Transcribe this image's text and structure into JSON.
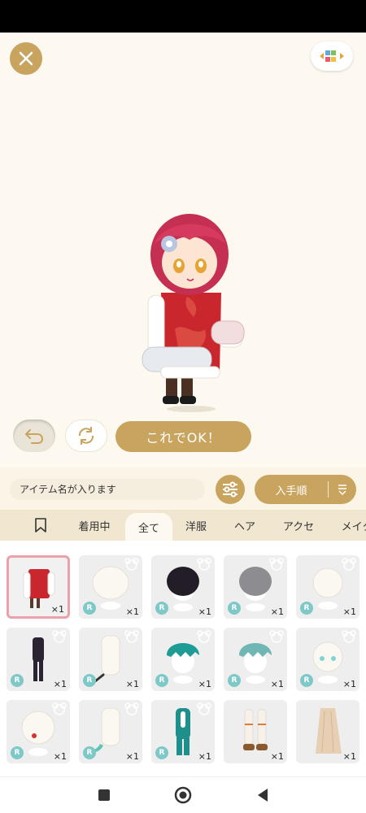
{
  "header": {
    "close_icon": "close-icon",
    "switch_icon": "color-blocks-icon"
  },
  "actions": {
    "undo_icon": "undo-icon",
    "rotate_icon": "rotate-icon",
    "confirm_label": "これでOK！"
  },
  "search": {
    "placeholder": "アイテム名が入ります",
    "filter_icon": "sliders-icon",
    "sort_label": "入手順",
    "sort_icon": "sort-order-icon"
  },
  "tabs": [
    {
      "label": "",
      "icon": "bookmark-icon"
    },
    {
      "label": "着用中"
    },
    {
      "label": "全て",
      "active": true
    },
    {
      "label": "洋服"
    },
    {
      "label": "ヘア"
    },
    {
      "label": "アクセ"
    },
    {
      "label": "メイク"
    }
  ],
  "items": [
    {
      "name": "red china dress",
      "qty": "×1",
      "badge": "",
      "selected": true
    },
    {
      "name": "white short hair",
      "qty": "×1",
      "badge": "R"
    },
    {
      "name": "black bob hair",
      "qty": "×1",
      "badge": "R"
    },
    {
      "name": "gray bob hair",
      "qty": "×1",
      "badge": "R"
    },
    {
      "name": "white hair accessory",
      "qty": "×1",
      "badge": "R"
    },
    {
      "name": "black outfit",
      "qty": "×1",
      "badge": "R"
    },
    {
      "name": "white tail",
      "qty": "×1",
      "badge": "R"
    },
    {
      "name": "teal short hair",
      "qty": "×1",
      "badge": "R"
    },
    {
      "name": "mint short hair",
      "qty": "×1",
      "badge": "R"
    },
    {
      "name": "light blue eyes",
      "qty": "×1",
      "badge": "R"
    },
    {
      "name": "red ribbon",
      "qty": "×1",
      "badge": "R"
    },
    {
      "name": "mermaid tail",
      "qty": "×1",
      "badge": "R"
    },
    {
      "name": "teal costume",
      "qty": "×1",
      "badge": "R"
    },
    {
      "name": "white boots",
      "qty": "×1",
      "badge": ""
    },
    {
      "name": "beige skirt",
      "qty": "×1",
      "badge": ""
    }
  ],
  "colors": {
    "accent_gold": "#c8a45e",
    "background_cream": "#fdf9f0",
    "tab_bar": "#f1e6cf",
    "selected_border": "#e9a2aa",
    "rarity_badge": "#7fc8c8"
  },
  "nav": {
    "recents_icon": "square-icon",
    "home_icon": "circle-icon",
    "back_icon": "back-triangle-icon"
  }
}
